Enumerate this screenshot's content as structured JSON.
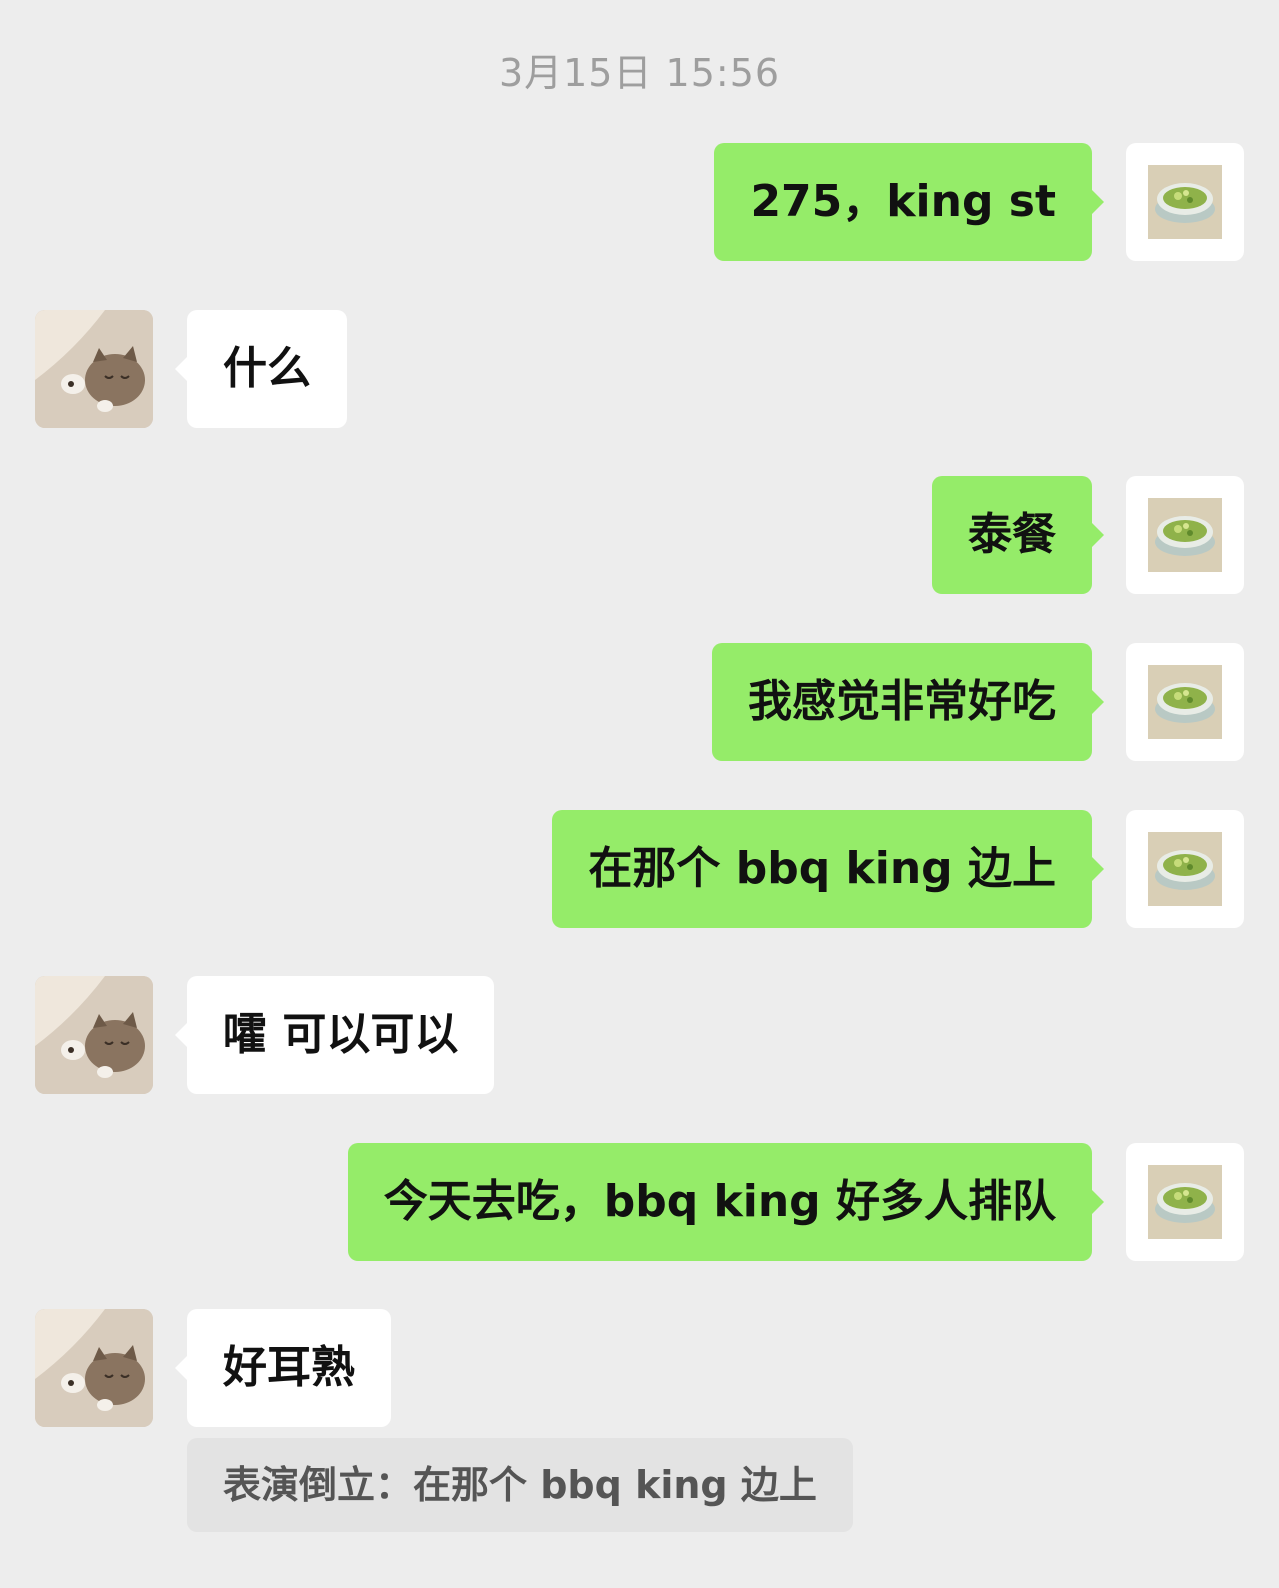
{
  "timestamp": "3月15日 15:56",
  "messages": [
    {
      "side": "out",
      "text": "275，king st"
    },
    {
      "side": "in",
      "text": "什么"
    },
    {
      "side": "out",
      "text": "泰餐"
    },
    {
      "side": "out",
      "text": "我感觉非常好吃"
    },
    {
      "side": "out",
      "text": "在那个 bbq king 边上"
    },
    {
      "side": "in",
      "text": "嚯 可以可以"
    },
    {
      "side": "out",
      "text": "今天去吃，bbq king 好多人排队"
    },
    {
      "side": "in",
      "text": "好耳熟"
    }
  ],
  "quote": "表演倒立：在那个 bbq king 边上",
  "icons": {
    "self_avatar": "bowl-painting-avatar",
    "contact_avatar": "kitten-avatar"
  },
  "colors": {
    "background": "#ededed",
    "outgoing_bubble": "#95ec69",
    "incoming_bubble": "#ffffff",
    "quote_box": "#e3e3e3"
  }
}
